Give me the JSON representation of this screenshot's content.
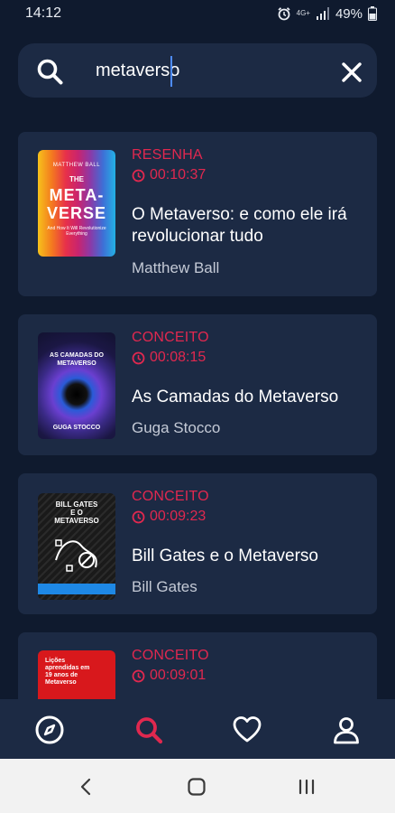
{
  "status_bar": {
    "time": "14:12",
    "network": "4G+",
    "battery": "49%"
  },
  "search": {
    "value": "metaverso",
    "placeholder": ""
  },
  "results": [
    {
      "category": "RESENHA",
      "duration": "00:10:37",
      "title": " O Metaverso: e como ele irá revolucionar tudo",
      "author": "Matthew Ball",
      "cover": {
        "top_text": "MATTHEW BALL",
        "line1": "THE",
        "line2": "META-",
        "line3": "VERSE",
        "sub": "And How It Will Revolutionize Everything"
      }
    },
    {
      "category": "CONCEITO",
      "duration": "00:08:15",
      "title": "As Camadas do Metaverso",
      "author": "Guga Stocco",
      "cover": {
        "line1": "AS CAMADAS DO",
        "line2": "METAVERSO",
        "footer": "GUGA STOCCO"
      }
    },
    {
      "category": "CONCEITO",
      "duration": "00:09:23",
      "title": "Bill Gates e o Metaverso",
      "author": "Bill Gates",
      "cover": {
        "line1": "BILL GATES",
        "line2": "E O",
        "line3": "METAVERSO"
      }
    },
    {
      "category": "CONCEITO",
      "duration": "00:09:01",
      "title": "",
      "author": "",
      "cover": {
        "line1": "Lições",
        "line2": "aprendidas em",
        "line3": "19 anos de",
        "line4": "Metaverso"
      }
    }
  ],
  "bottom_nav": {
    "items": [
      "compass-icon",
      "search-icon",
      "heart-icon",
      "user-icon"
    ],
    "active": "search-icon"
  },
  "colors": {
    "background": "#0f1a2e",
    "card": "#1c2a44",
    "accent": "#e0284f",
    "text": "#ffffff",
    "muted": "#c4cad6"
  }
}
